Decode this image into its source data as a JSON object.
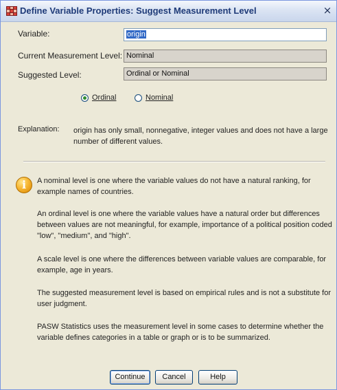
{
  "dialog": {
    "title": "Define Variable Properties: Suggest Measurement Level",
    "close_glyph": "×"
  },
  "fields": {
    "variable_label": "Variable:",
    "variable_value": "origin",
    "current_label": "Current Measurement Level:",
    "current_value": "Nominal",
    "suggested_label": "Suggested Level:",
    "suggested_value": "Ordinal or Nominal"
  },
  "radio": {
    "ordinal_label": "Ordinal",
    "nominal_label": "Nominal",
    "selected": "Ordinal"
  },
  "explanation": {
    "label": "Explanation:",
    "text": "origin has only small, nonnegative, integer values and does not have a large number of different values."
  },
  "info": {
    "icon": "info-icon",
    "paragraphs": [
      "A nominal level is one where the variable values do not have a natural ranking, for example names of countries.",
      "An ordinal level is one where the variable values have a natural order but differences between values are not meaningful, for example, importance of a political position coded \"low\", \"medium\", and \"high\".",
      "A scale level is one where the differences between variable values are comparable, for example, age in years.",
      "The suggested measurement level is based on empirical rules and is not a substitute for user judgment.",
      "PASW Statistics uses the measurement level in some cases to determine whether the variable defines categories in a table or graph or is to be summarized."
    ]
  },
  "buttons": {
    "continue": "Continue",
    "cancel": "Cancel",
    "help": "Help"
  },
  "colors": {
    "title_text": "#1e3a78",
    "selection": "#3169c6",
    "dialog_bg": "#ece9d8"
  }
}
